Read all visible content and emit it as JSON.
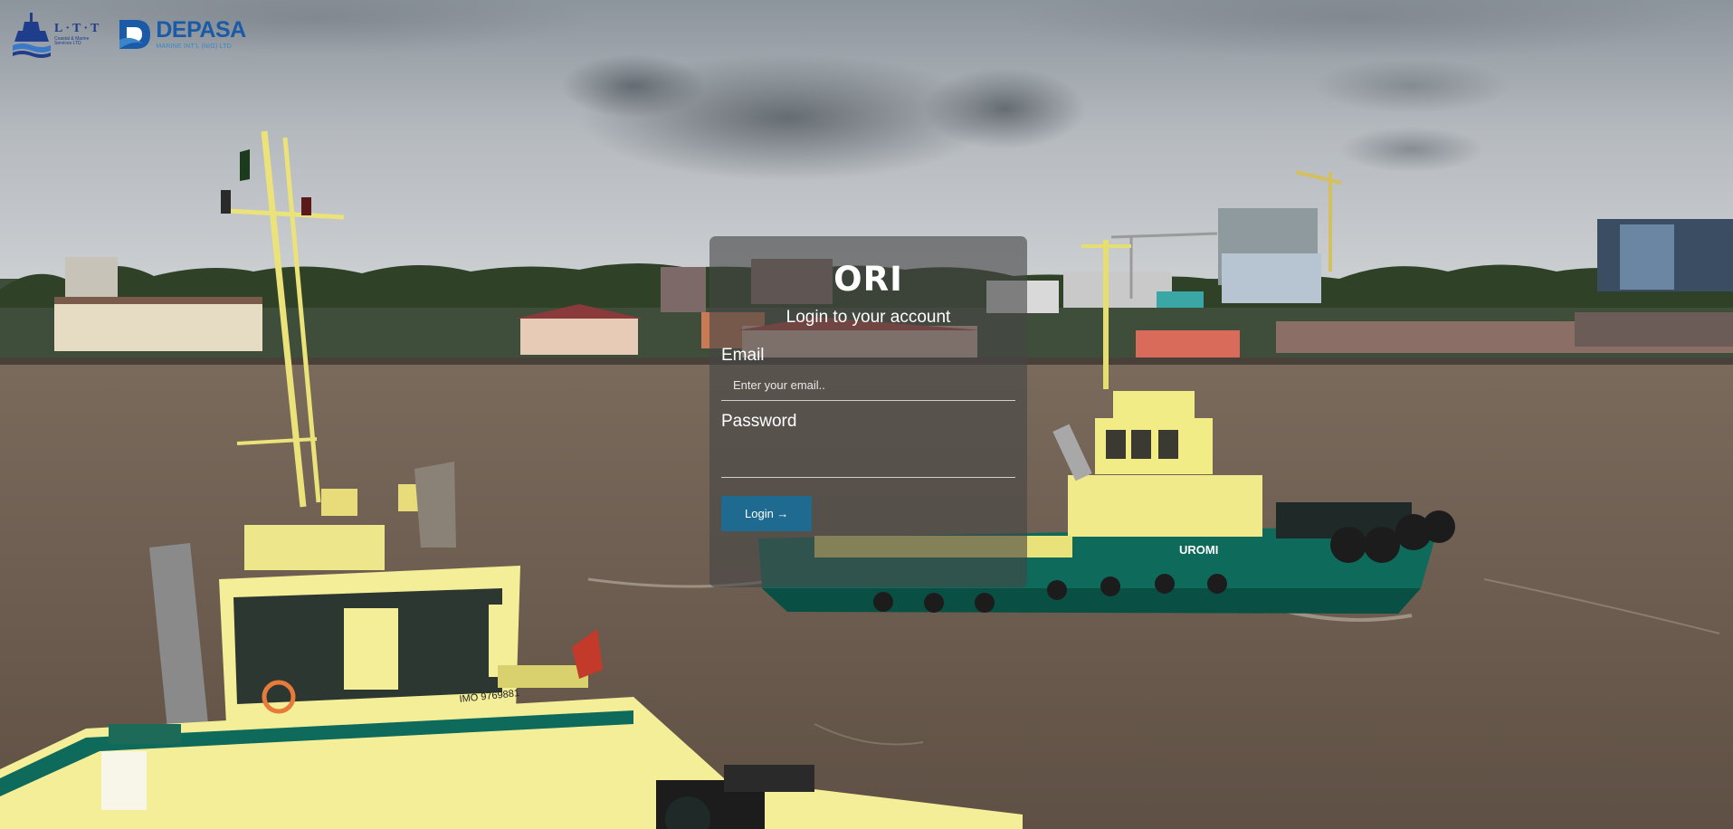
{
  "logos": {
    "ltt_main": "L·T·T",
    "ltt_sub": "Coastal & Marine Services LTD",
    "depasa_main": "DEPASA",
    "depasa_sub": "MARINE INT'L (NIG) LTD"
  },
  "login": {
    "brand": "ORI",
    "subtitle": "Login to your account",
    "email_label": "Email",
    "email_placeholder": "Enter your email..",
    "email_value": "",
    "password_label": "Password",
    "password_value": "",
    "login_button": "Login →"
  },
  "background": {
    "tug_name": "UROMI",
    "tug_hull_text": "IMO 9769881"
  },
  "colors": {
    "login_button": "#1e6a90",
    "card_overlay": "#464646",
    "tug_hull": "#0e6a5a",
    "tug_superstructure": "#f1ec86",
    "river": "#6f5f52",
    "sky": "#b7bcc1"
  }
}
